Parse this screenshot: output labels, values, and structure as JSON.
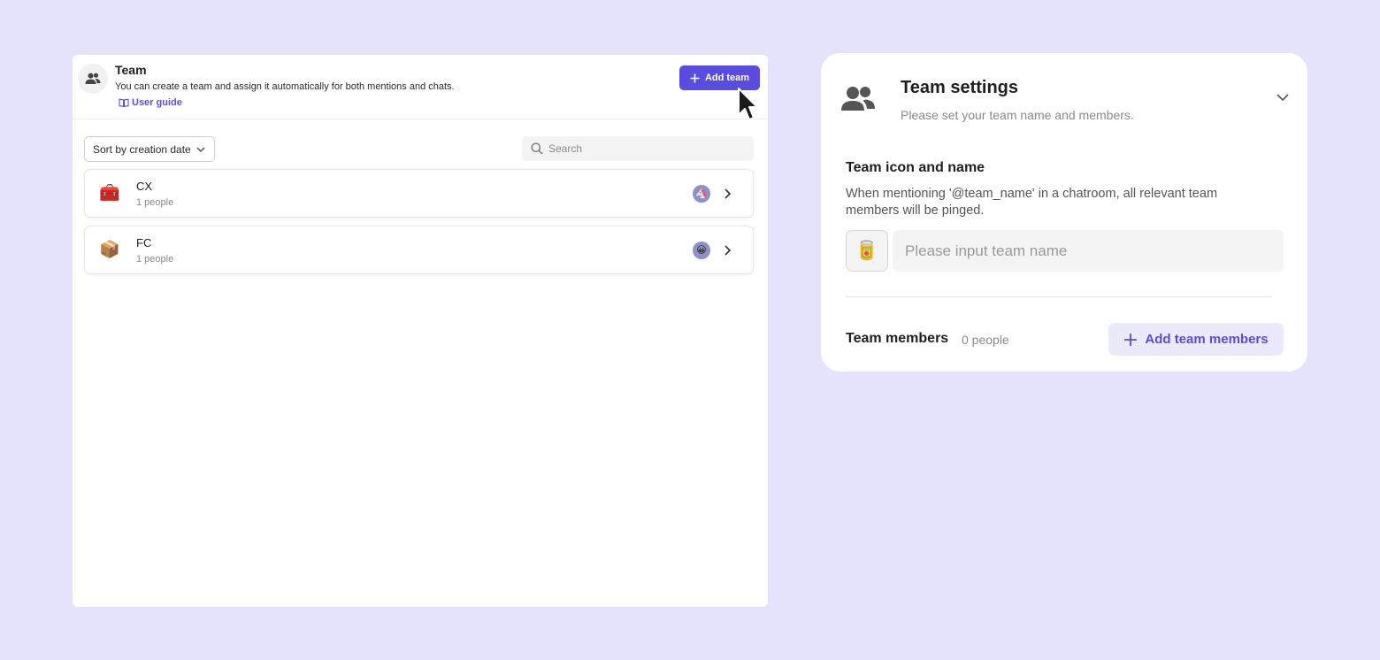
{
  "team_panel": {
    "title": "Team",
    "description": "You can create a team and assign it automatically for both mentions and chats.",
    "guide_link": "User guide",
    "add_button": "Add team",
    "sort": {
      "selected": "Sort by creation date"
    },
    "search": {
      "placeholder": "Search"
    },
    "teams": [
      {
        "emoji": "🧰",
        "name": "CX",
        "count": "1 people",
        "member_emoji": "🦄"
      },
      {
        "emoji": "📦",
        "name": "FC",
        "count": "1 people",
        "member_emoji": "😀"
      }
    ]
  },
  "settings_panel": {
    "title": "Team settings",
    "subtitle": "Please set your team name and members.",
    "icon_section_label": "Team icon and name",
    "icon_section_desc": "When mentioning '@team_name' in a chatroom, all relevant team members will be pinged.",
    "selected_icon": "🥫",
    "name_input": {
      "value": "",
      "placeholder": "Please input team name"
    },
    "members_label": "Team members",
    "members_count": "0 people",
    "add_members_button": "Add team members"
  },
  "colors": {
    "background": "#e3e3fc",
    "accent": "#5b4ce0",
    "accent_soft": "#ebeafd"
  },
  "icons": {
    "header": "people-icon",
    "guide": "book-icon",
    "add": "plus-icon",
    "sort": "chevron-down-icon",
    "search": "search-icon",
    "row": "chevron-right-icon",
    "collapse": "chevron-down-icon"
  }
}
